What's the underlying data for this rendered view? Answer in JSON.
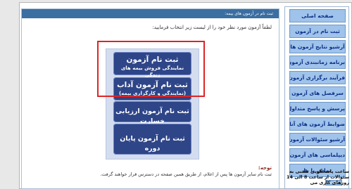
{
  "content": {
    "header": "ثبت نام در آزمون های بیمه:",
    "intro": "لطفاً آزمون مورد نظر خود را از لیست زیر انتخاب فرمایید:",
    "buttons": [
      {
        "line1": "ثبت نام آزمون",
        "line2": "نمایندگی فروش بیمه های زندگی"
      },
      {
        "line1": "ثبت نام آزمون آداب",
        "line2": "(نمایندگی و کارگزاری بیمه)"
      },
      {
        "line1": "ثبت نام آزمون ارزیابی خسارت",
        "line2": ""
      },
      {
        "line1": "ثبت نام آزمون پایان دوره",
        "line2": ""
      }
    ],
    "note_title": "توجه:",
    "note_text": "ثبت نام سایر آزمون ها پس از اعلام، از طریق همین صفحه در دسترس قرار خواهند گرفت."
  },
  "sidebar": {
    "items": [
      "صفحه اصلی",
      "ثبت نام در آزمون",
      "آرشیو نتایج آزمون ها",
      "برنامه زمانبندی آزمون ها",
      "فرآیند برگزاری آزمون ها",
      "سرفصل های آزمون",
      "پرسش و پاسخ متداول",
      "ضوابط آزمون های آنلاین",
      "آرشیو سئوالات آزمون ها",
      "دیپلماسی های آزمون",
      "تماس با ما"
    ],
    "news_tab": "اطلاعیه",
    "news_text": "ساعت پاسخگویی تلفنی به سئوالات از ساعت 8 الی 14 روزهای کاری می"
  }
}
